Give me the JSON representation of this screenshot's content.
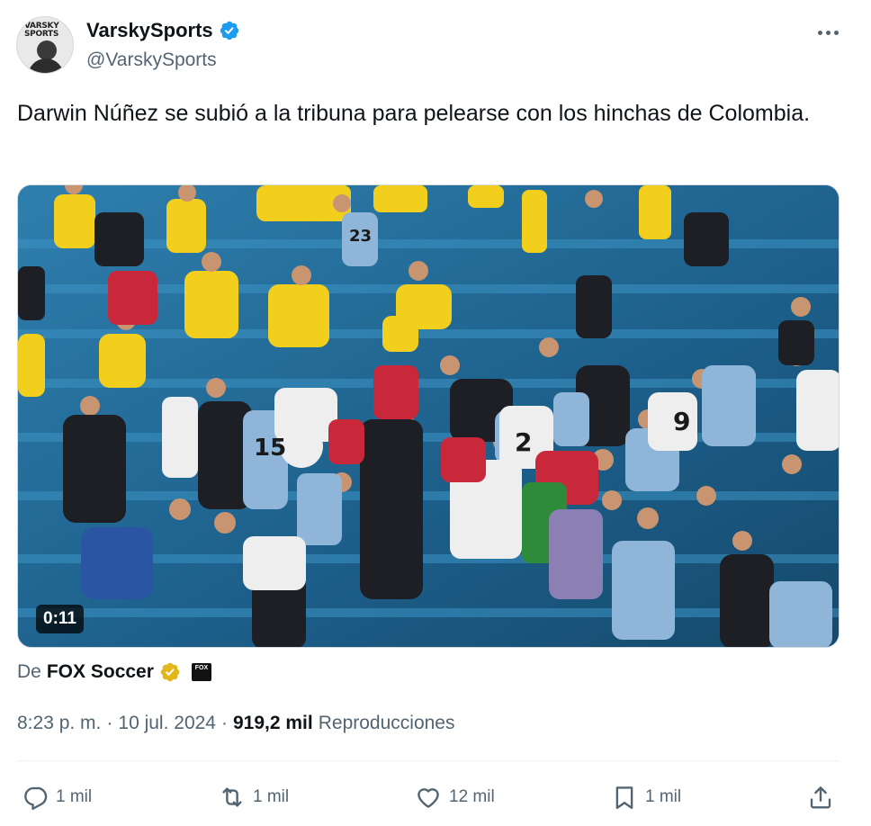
{
  "author": {
    "display_name": "VarskySports",
    "handle": "@VarskySports",
    "avatar_text": "VARSKY SPORTS",
    "verified_icon": "verified-badge-icon"
  },
  "tweet": {
    "text": "Darwin Núñez se subió a la tribuna para pelearse con los hinchas de Colombia."
  },
  "media": {
    "type": "video",
    "duration": "0:11",
    "jersey_numbers": [
      "15",
      "2",
      "9",
      "23"
    ]
  },
  "source": {
    "prefix": "De",
    "name": "FOX Soccer",
    "badge_icon": "gold-verified-badge-icon",
    "logo_text": "FOX"
  },
  "meta": {
    "time": "8:23 p. m.",
    "sep1": "·",
    "date": "10 jul. 2024",
    "sep2": "·",
    "views_count": "919,2 mil",
    "views_label": "Reproducciones"
  },
  "actions": {
    "reply_count": "1 mil",
    "repost_count": "1 mil",
    "like_count": "12 mil",
    "bookmark_count": "1 mil"
  },
  "colors": {
    "accent": "#1d9bf0",
    "gold": "#e2b719",
    "secondary_text": "#536471"
  }
}
